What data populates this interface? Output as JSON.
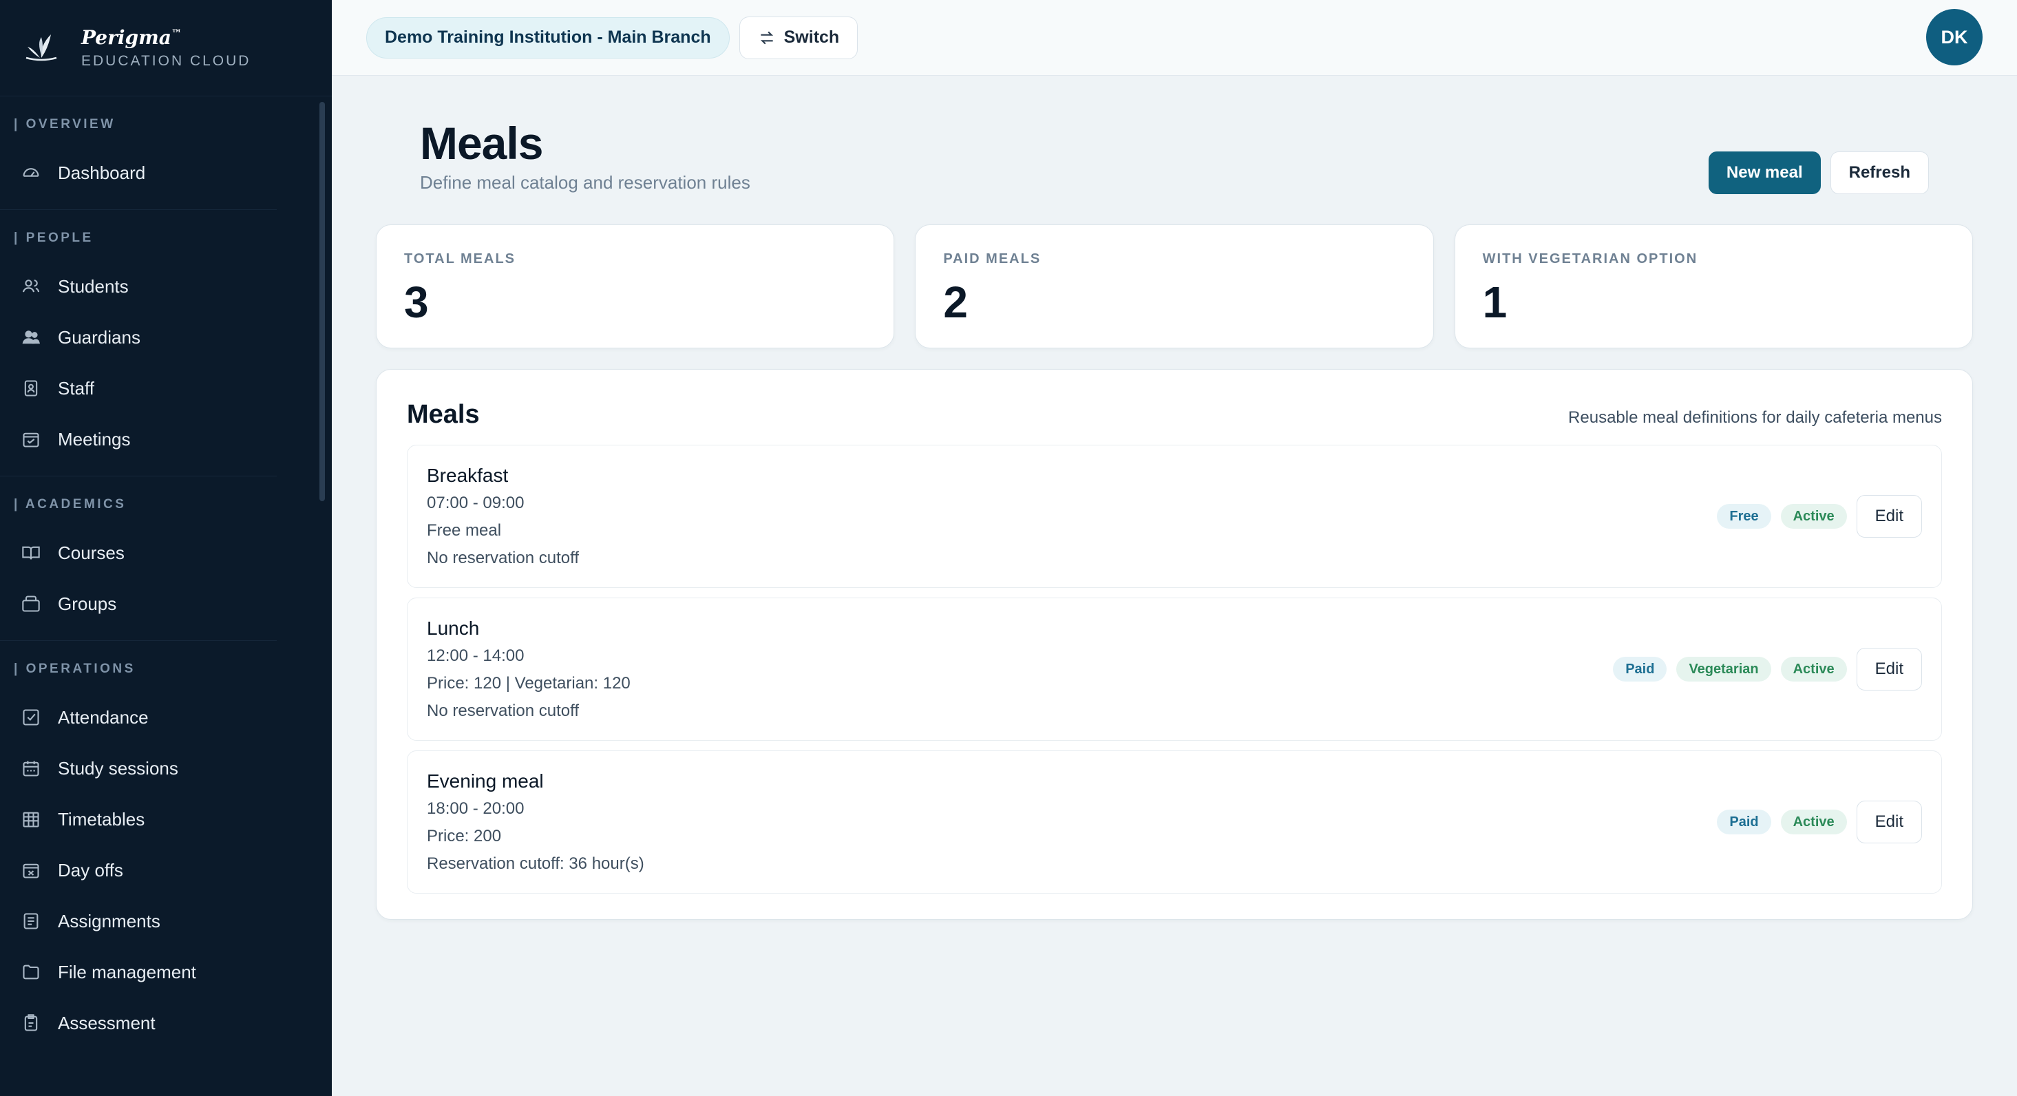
{
  "brand": {
    "name": "Perigma",
    "trademark": "™",
    "subtitle": "EDUCATION CLOUD"
  },
  "sidebar": {
    "sections": [
      {
        "header": "| OVERVIEW",
        "items": [
          {
            "label": "Dashboard",
            "icon": "dashboard-icon"
          }
        ]
      },
      {
        "header": "| PEOPLE",
        "items": [
          {
            "label": "Students",
            "icon": "students-icon"
          },
          {
            "label": "Guardians",
            "icon": "guardians-icon"
          },
          {
            "label": "Staff",
            "icon": "staff-icon"
          },
          {
            "label": "Meetings",
            "icon": "meetings-icon"
          }
        ]
      },
      {
        "header": "| ACADEMICS",
        "items": [
          {
            "label": "Courses",
            "icon": "courses-icon"
          },
          {
            "label": "Groups",
            "icon": "groups-icon"
          }
        ]
      },
      {
        "header": "| OPERATIONS",
        "items": [
          {
            "label": "Attendance",
            "icon": "attendance-icon"
          },
          {
            "label": "Study sessions",
            "icon": "study-sessions-icon"
          },
          {
            "label": "Timetables",
            "icon": "timetables-icon"
          },
          {
            "label": "Day offs",
            "icon": "day-offs-icon"
          },
          {
            "label": "Assignments",
            "icon": "assignments-icon"
          },
          {
            "label": "File management",
            "icon": "file-management-icon"
          },
          {
            "label": "Assessment",
            "icon": "assessment-icon"
          }
        ]
      }
    ]
  },
  "topbar": {
    "org": "Demo Training Institution - Main Branch",
    "switch_label": "Switch",
    "avatar": "DK"
  },
  "page": {
    "title": "Meals",
    "subtitle": "Define meal catalog and reservation rules",
    "new_label": "New meal",
    "refresh_label": "Refresh"
  },
  "stats": [
    {
      "label": "TOTAL MEALS",
      "value": "3"
    },
    {
      "label": "PAID MEALS",
      "value": "2"
    },
    {
      "label": "WITH VEGETARIAN OPTION",
      "value": "1"
    }
  ],
  "panel": {
    "title": "Meals",
    "note": "Reusable meal definitions for daily cafeteria menus",
    "edit_label": "Edit",
    "meals": [
      {
        "name": "Breakfast",
        "lines": [
          "07:00 - 09:00",
          "Free meal",
          "No reservation cutoff"
        ],
        "badges": [
          {
            "text": "Free",
            "tone": "blue"
          },
          {
            "text": "Active",
            "tone": "green"
          }
        ]
      },
      {
        "name": "Lunch",
        "lines": [
          "12:00 - 14:00",
          "Price: 120 | Vegetarian: 120",
          "No reservation cutoff"
        ],
        "badges": [
          {
            "text": "Paid",
            "tone": "blue"
          },
          {
            "text": "Vegetarian",
            "tone": "green"
          },
          {
            "text": "Active",
            "tone": "green"
          }
        ]
      },
      {
        "name": "Evening meal",
        "lines": [
          "18:00 - 20:00",
          "Price: 200",
          "Reservation cutoff: 36 hour(s)"
        ],
        "badges": [
          {
            "text": "Paid",
            "tone": "blue"
          },
          {
            "text": "Active",
            "tone": "green"
          }
        ]
      }
    ]
  },
  "colors": {
    "sidebar_bg": "#0b1a2a",
    "primary": "#10627f",
    "badge_blue": "#1d6f93",
    "badge_green": "#2b8a58"
  }
}
